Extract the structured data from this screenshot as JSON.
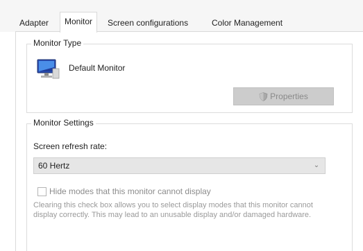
{
  "tabs": [
    {
      "label": "Adapter",
      "active": false
    },
    {
      "label": "Monitor",
      "active": true
    },
    {
      "label": "Screen configurations",
      "active": false
    },
    {
      "label": "Color Management",
      "active": false
    }
  ],
  "monitor_type": {
    "group_title": "Monitor Type",
    "monitor_name": "Default Monitor",
    "monitor_icon": "monitor-icon",
    "properties_button": {
      "label": "Properties",
      "icon": "shield-icon",
      "enabled": false
    }
  },
  "monitor_settings": {
    "group_title": "Monitor Settings",
    "refresh_rate_label": "Screen refresh rate:",
    "refresh_rate_value": "60 Hertz",
    "hide_modes": {
      "label": "Hide modes that this monitor cannot display",
      "checked": false,
      "enabled": false
    },
    "description": "Clearing this check box allows you to select display modes that this monitor cannot display correctly. This may lead to an unusable display and/or damaged hardware."
  },
  "colors": {
    "tabstrip_bg": "#f6f6f6",
    "border": "#d9d9d9",
    "disabled_button_bg": "#cccccc",
    "disabled_text": "#8c8c8c"
  }
}
